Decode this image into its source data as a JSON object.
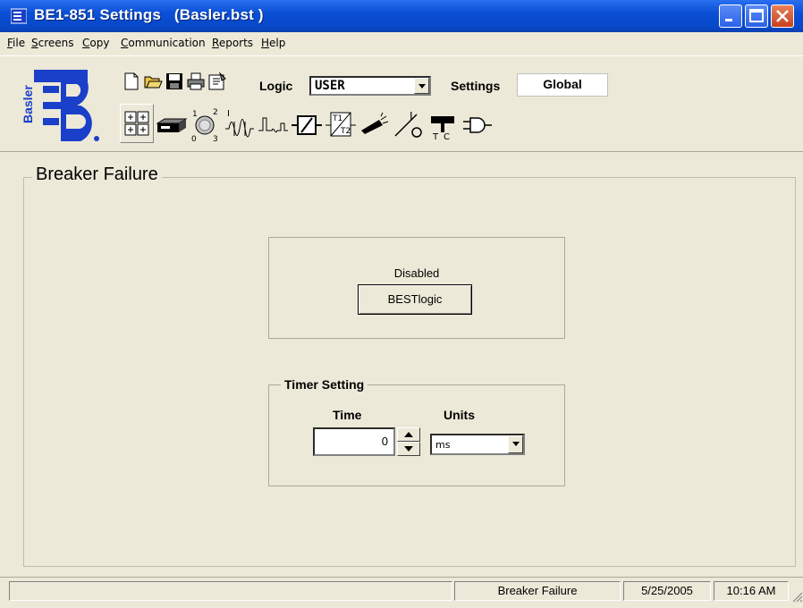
{
  "window": {
    "title": "BE1-851 Settings   (Basler.bst )"
  },
  "menu": [
    "File",
    "Screens",
    "Copy",
    "Communication",
    "Reports",
    "Help"
  ],
  "menu_underline": [
    "F",
    "S",
    "C",
    "C",
    "R",
    "H"
  ],
  "toolbar": {
    "logic_label": "Logic",
    "logic_value": "USER",
    "settings_label": "Settings",
    "settings_value": "Global",
    "logo_text": "Basler",
    "small_icons": [
      "new-file-icon",
      "open-folder-icon",
      "save-icon",
      "print-icon",
      "properties-icon"
    ],
    "screen_icons": [
      "grid-screen-icon",
      "relay-device-icon",
      "dial-switch-icon",
      "waveform-icon",
      "pulse-icon",
      "schmitt-icon",
      "timer-t1-t2-icon",
      "fault-probe-icon",
      "current-switch-icon",
      "breaker-tc-icon",
      "and-gate-icon"
    ]
  },
  "main": {
    "group_title": "Breaker Failure",
    "logic_status": "Disabled",
    "bestlogic_button": "BESTlogic",
    "timer_group_title": "Timer Setting",
    "time_label": "Time",
    "units_label": "Units",
    "time_value": "0",
    "units_value": "ms"
  },
  "statusbar": {
    "screen": "Breaker Failure",
    "date": "5/25/2005",
    "time": "10:16 AM"
  },
  "colors": {
    "titlebar": "#0a4fd6",
    "window_bg": "#ece9d8",
    "logo_blue": "#1a3fc8"
  }
}
